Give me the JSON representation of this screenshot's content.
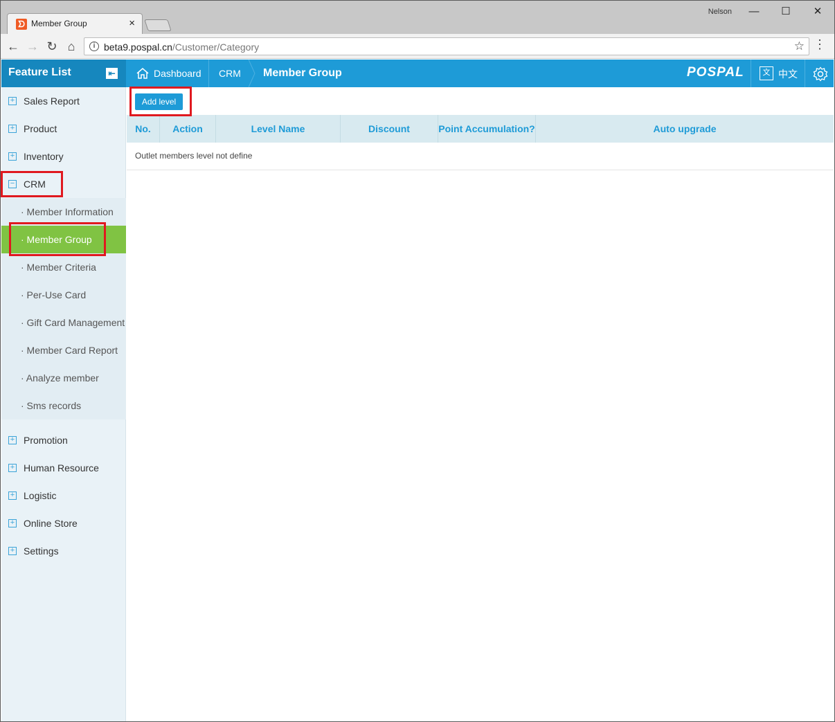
{
  "browser": {
    "tab_title": "Member Group",
    "tab_close": "×",
    "user": "Nelson",
    "url_host": "beta9.pospal.cn",
    "url_path": "/Customer/Category"
  },
  "header": {
    "feature_title": "Feature List",
    "breadcrumbs": [
      "Dashboard",
      "CRM",
      "Member Group"
    ],
    "logo": "POSPAL",
    "lang_label": "中文",
    "lang_icon": "文"
  },
  "sidebar": {
    "items": [
      {
        "label": "Sales Report"
      },
      {
        "label": "Product"
      },
      {
        "label": "Inventory"
      },
      {
        "label": "CRM"
      }
    ],
    "crm_sub": [
      {
        "label": "· Member Information"
      },
      {
        "label": "· Member Group"
      },
      {
        "label": "· Member Criteria"
      },
      {
        "label": "· Per-Use Card"
      },
      {
        "label": "· Gift Card Management"
      },
      {
        "label": "· Member Card Report"
      },
      {
        "label": "· Analyze member"
      },
      {
        "label": "· Sms records"
      }
    ],
    "items_after": [
      {
        "label": "Promotion"
      },
      {
        "label": "Human Resource"
      },
      {
        "label": "Logistic"
      },
      {
        "label": "Online Store"
      },
      {
        "label": "Settings"
      }
    ]
  },
  "main": {
    "add_button": "Add level",
    "columns": [
      "No.",
      "Action",
      "Level Name",
      "Discount",
      "Point Accumulation?",
      "Auto upgrade"
    ],
    "empty_message": "Outlet members level not define"
  },
  "colors": {
    "accent": "#1e9bd7",
    "active": "#80c343",
    "highlight": "#e0191f"
  }
}
